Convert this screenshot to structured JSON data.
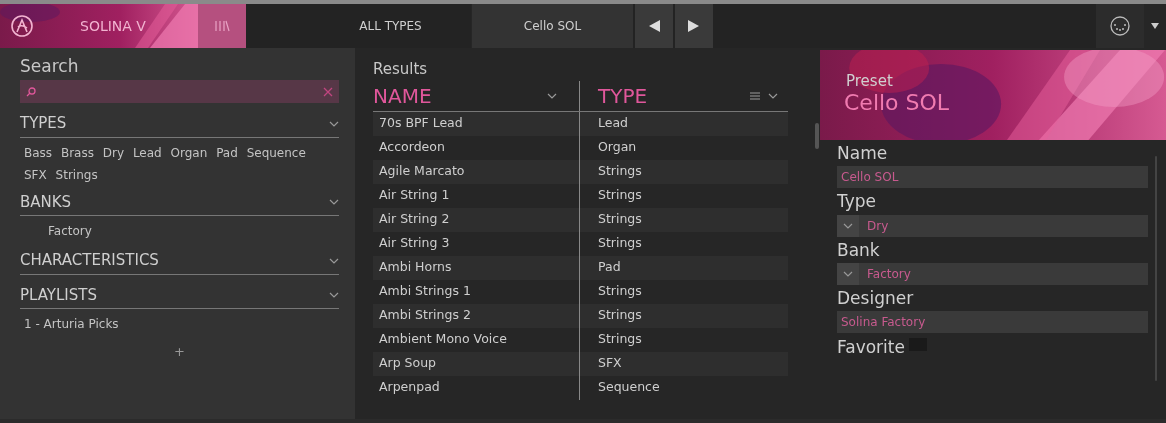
{
  "header": {
    "brand": "SOLINA V",
    "library_active": true,
    "type_filter": "ALL TYPES",
    "preset_name": "Cello SOL"
  },
  "sidebar": {
    "title": "Search",
    "sections": [
      {
        "title": "TYPES",
        "kind": "tags",
        "items": [
          "Bass",
          "Brass",
          "Dry",
          "Lead",
          "Organ",
          "Pad",
          "Sequence",
          "SFX",
          "Strings"
        ]
      },
      {
        "title": "BANKS",
        "kind": "list",
        "items": [
          "Factory"
        ]
      },
      {
        "title": "CHARACTERISTICS",
        "kind": "list"
      },
      {
        "title": "PLAYLISTS",
        "kind": "playlists",
        "items": [
          "1 - Arturia Picks"
        ],
        "add": "+"
      }
    ]
  },
  "results": {
    "title": "Results",
    "columns": [
      "NAME",
      "TYPE"
    ],
    "rows": [
      {
        "name": "70s BPF Lead",
        "type": "Lead"
      },
      {
        "name": "Accordeon",
        "type": "Organ"
      },
      {
        "name": "Agile Marcato",
        "type": "Strings"
      },
      {
        "name": "Air String 1",
        "type": "Strings"
      },
      {
        "name": "Air String 2",
        "type": "Strings"
      },
      {
        "name": "Air String 3",
        "type": "Strings"
      },
      {
        "name": "Ambi Horns",
        "type": "Pad"
      },
      {
        "name": "Ambi Strings 1",
        "type": "Strings"
      },
      {
        "name": "Ambi Strings 2",
        "type": "Strings"
      },
      {
        "name": "Ambient Mono Voice",
        "type": "Strings"
      },
      {
        "name": "Arp Soup",
        "type": "SFX"
      },
      {
        "name": "Arpenpad",
        "type": "Sequence"
      }
    ]
  },
  "preset": {
    "title": "Preset",
    "name": "Cello SOL",
    "fields": [
      {
        "label": "Name",
        "kind": "text",
        "value": "Cello SOL"
      },
      {
        "label": "Type",
        "kind": "dropdown",
        "value": "Dry"
      },
      {
        "label": "Bank",
        "kind": "dropdown",
        "value": "Factory"
      },
      {
        "label": "Designer",
        "kind": "text",
        "value": "Solina Factory"
      },
      {
        "label": "Favorite",
        "kind": "checkbox",
        "checked": false
      }
    ]
  }
}
